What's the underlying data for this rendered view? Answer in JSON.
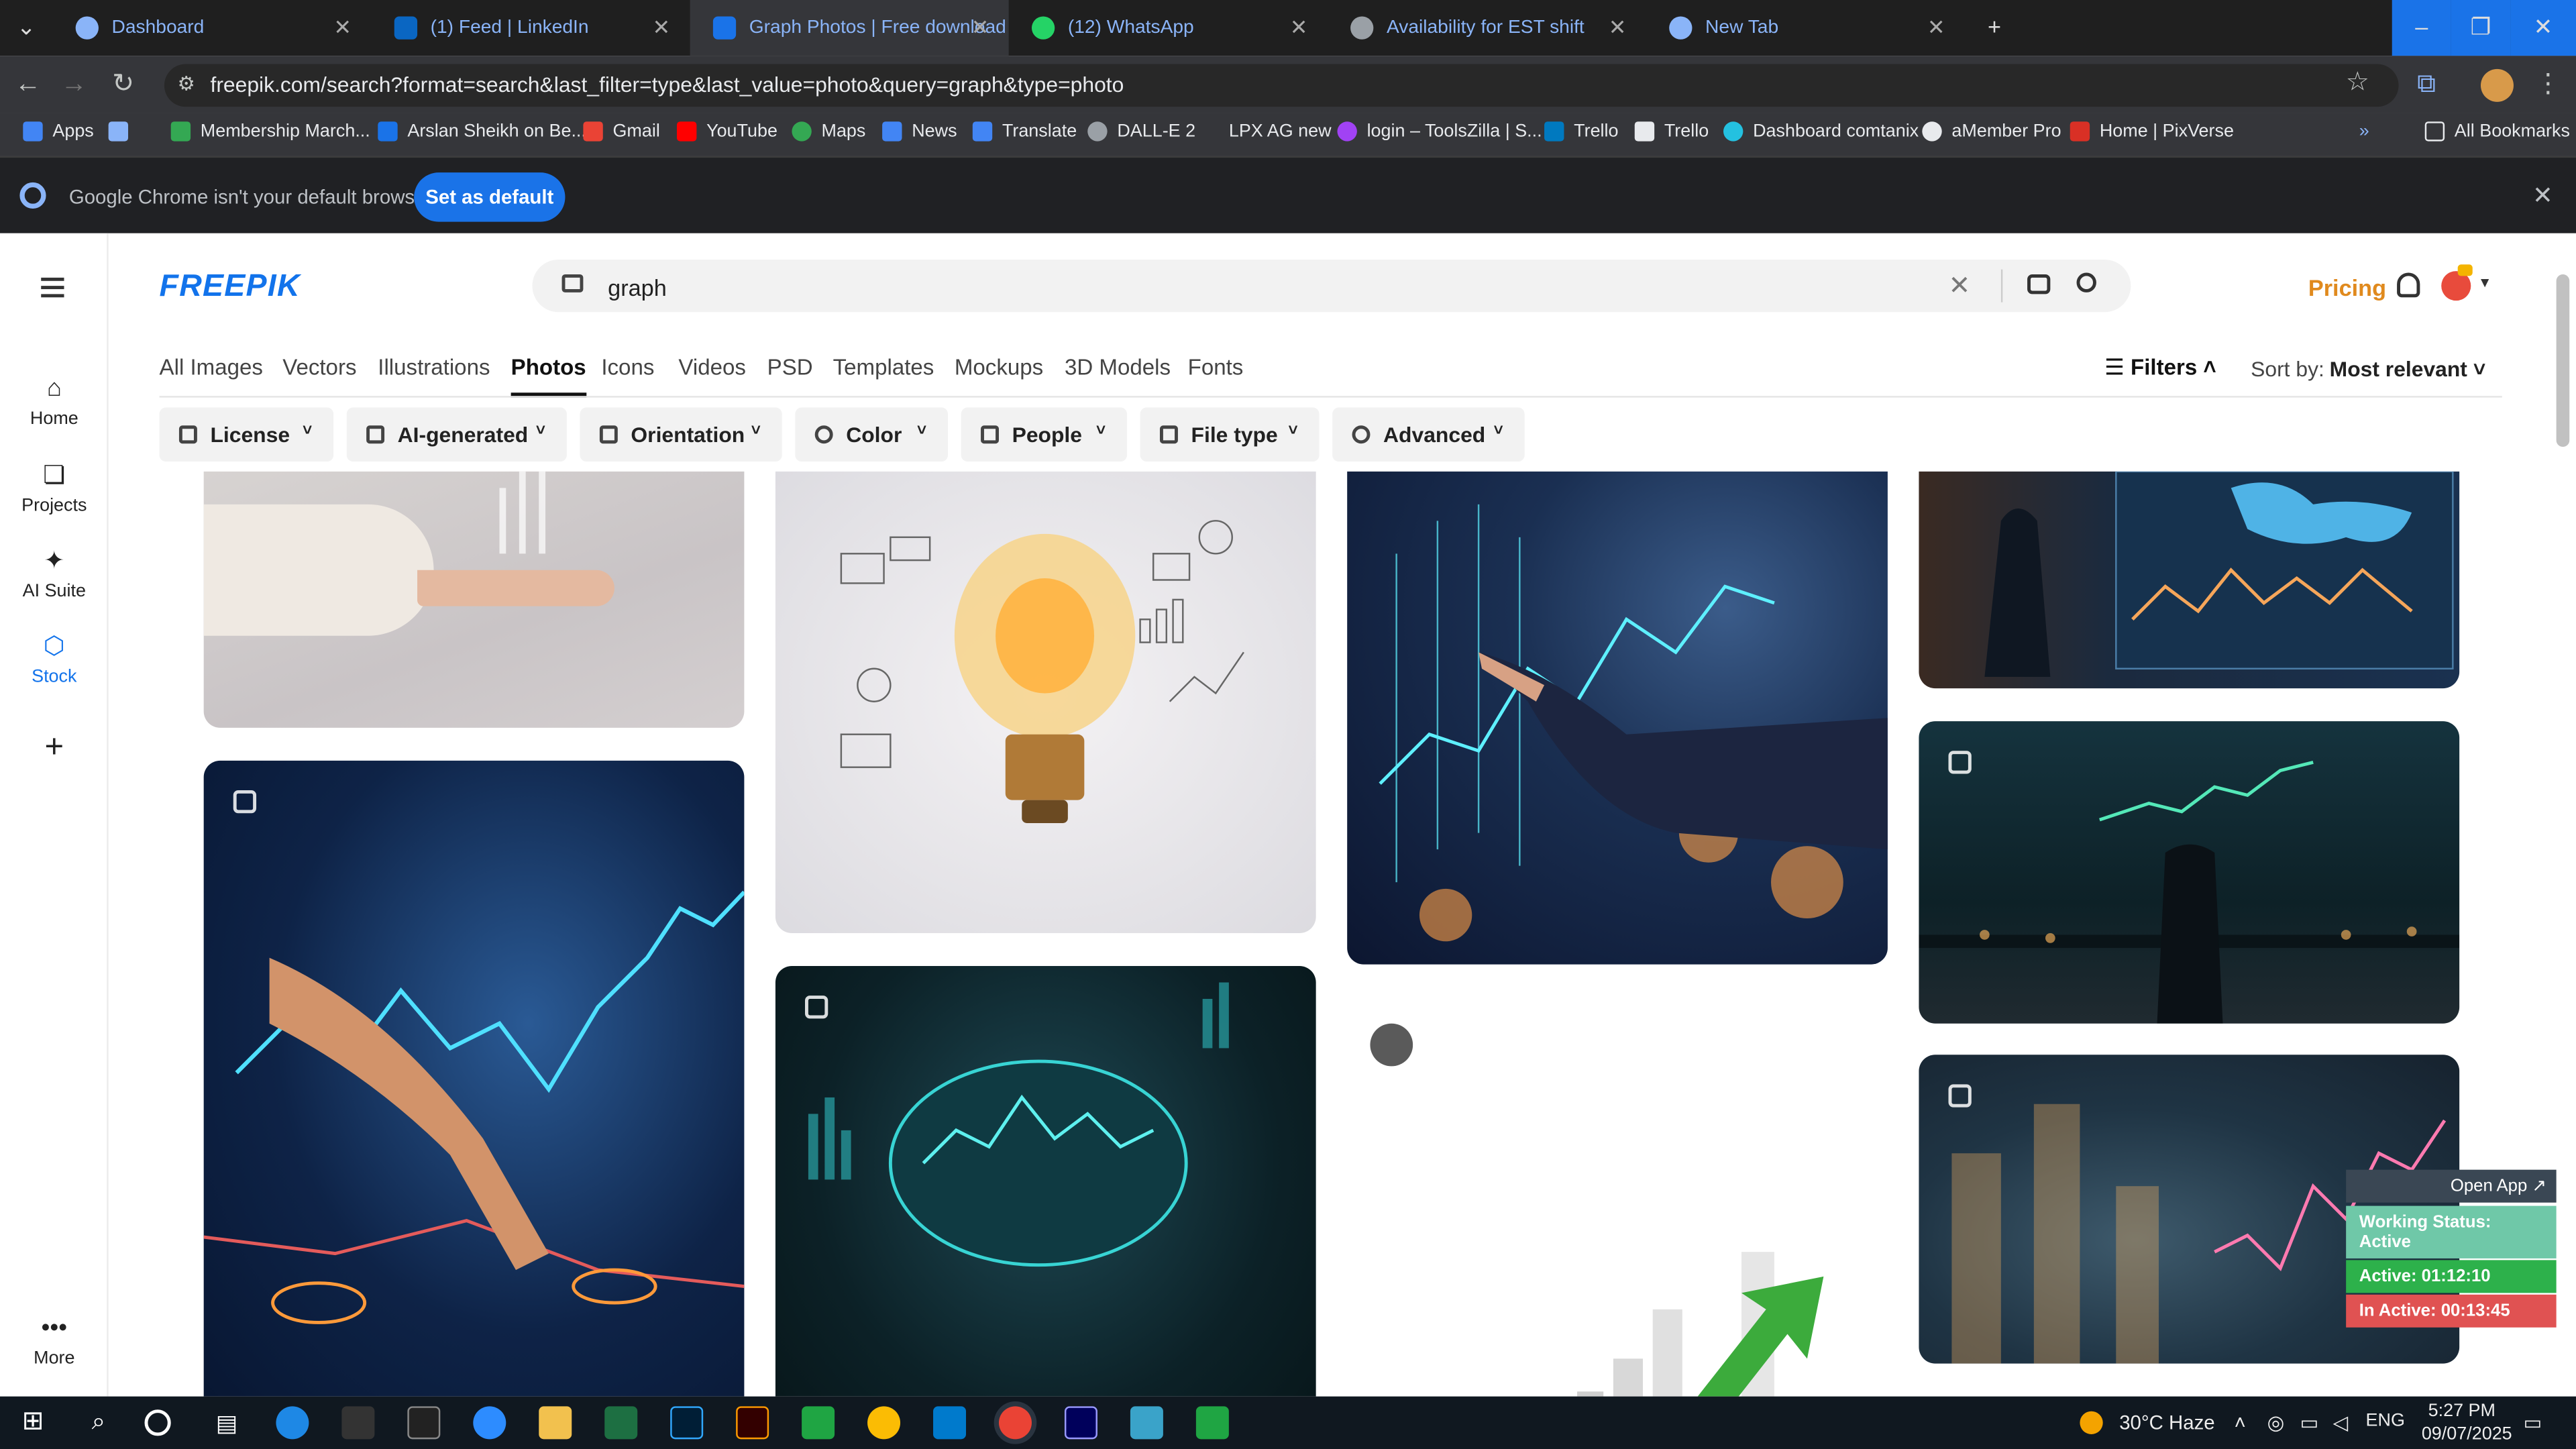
{
  "browser": {
    "tabs": [
      {
        "title": "Dashboard",
        "active": false
      },
      {
        "title": "(1) Feed | LinkedIn",
        "active": false
      },
      {
        "title": "Graph Photos | Free download",
        "active": true
      },
      {
        "title": "(12) WhatsApp",
        "active": false
      },
      {
        "title": "Availability for EST shift",
        "active": false
      },
      {
        "title": "New Tab",
        "active": false
      }
    ],
    "url": "freepik.com/search?format=search&last_filter=type&last_value=photo&query=graph&type=photo",
    "bookmarks": [
      "Apps",
      "Membership March...",
      "Arslan Sheikh on Be...",
      "Gmail",
      "YouTube",
      "Maps",
      "News",
      "Translate",
      "DALL-E 2",
      "LPX AG new",
      "login – ToolsZilla | S...",
      "Trello",
      "Trello",
      "Dashboard comtanix",
      "aMember Pro",
      "Home | PixVerse"
    ],
    "all_bookmarks_label": "All Bookmarks"
  },
  "infobar": {
    "message": "Google Chrome isn't your default browser",
    "button": "Set as default"
  },
  "freepik": {
    "logo": "FREEPIK",
    "search_query": "graph",
    "pricing": "Pricing",
    "left_nav": [
      {
        "label": "Home",
        "icon": "home-icon"
      },
      {
        "label": "Projects",
        "icon": "projects-icon"
      },
      {
        "label": "AI Suite",
        "icon": "ai-suite-icon"
      },
      {
        "label": "Stock",
        "icon": "stock-icon",
        "active": true
      },
      {
        "label": "",
        "icon": "add-icon"
      },
      {
        "label": "More",
        "icon": "more-icon"
      }
    ],
    "content_tabs": [
      "All Images",
      "Vectors",
      "Illustrations",
      "Photos",
      "Icons",
      "Videos",
      "PSD",
      "Templates",
      "Mockups",
      "3D Models",
      "Fonts"
    ],
    "active_tab": "Photos",
    "filters_label": "Filters",
    "sort_label": "Sort by:",
    "sort_value": "Most relevant",
    "filter_chips": [
      "License",
      "AI-generated",
      "Orientation",
      "Color",
      "People",
      "File type",
      "Advanced"
    ]
  },
  "widget": {
    "open_app": "Open App ↗",
    "status": "Working Status: Active",
    "active": "Active: 01:12:10",
    "inactive": "In Active: 00:13:45"
  },
  "taskbar": {
    "weather": "30°C  Haze",
    "lang": "ENG",
    "time": "5:27 PM",
    "date": "09/07/2025"
  }
}
